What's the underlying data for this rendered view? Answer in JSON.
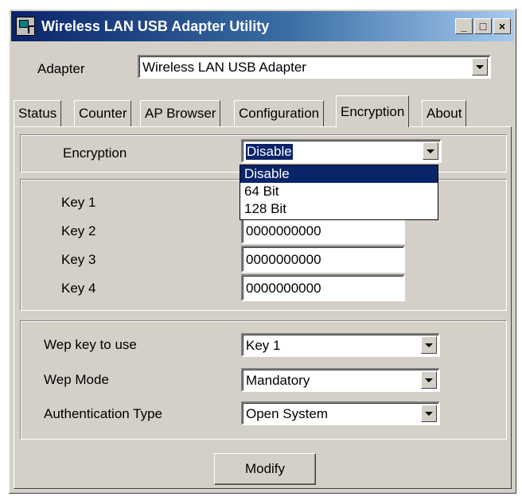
{
  "window": {
    "title": "Wireless LAN USB Adapter Utility",
    "controls": [
      "_",
      "□",
      "×"
    ]
  },
  "adapter": {
    "label": "Adapter",
    "value": "Wireless LAN USB Adapter"
  },
  "tabs": [
    {
      "label": "Status"
    },
    {
      "label": "Counter"
    },
    {
      "label": "AP Browser"
    },
    {
      "label": "Configuration"
    },
    {
      "label": "Encryption",
      "active": true
    },
    {
      "label": "About"
    }
  ],
  "encryption": {
    "label": "Encryption",
    "value": "Disable",
    "options": [
      "Disable",
      "64 Bit",
      "128 Bit"
    ],
    "highlighted": "Disable"
  },
  "keys": [
    {
      "label": "Key 1",
      "value": ""
    },
    {
      "label": "Key 2",
      "value": "0000000000"
    },
    {
      "label": "Key 3",
      "value": "0000000000"
    },
    {
      "label": "Key 4",
      "value": "0000000000"
    }
  ],
  "wep": {
    "key_label": "Wep key to use",
    "key_value": "Key 1",
    "mode_label": "Wep Mode",
    "mode_value": "Mandatory",
    "auth_label": "Authentication Type",
    "auth_value": "Open System"
  },
  "modify_button": "Modify",
  "colors": {
    "face": "#d4d0c8",
    "title_start": "#0a246a",
    "title_end": "#a6caf0",
    "selection": "#0a246a"
  }
}
